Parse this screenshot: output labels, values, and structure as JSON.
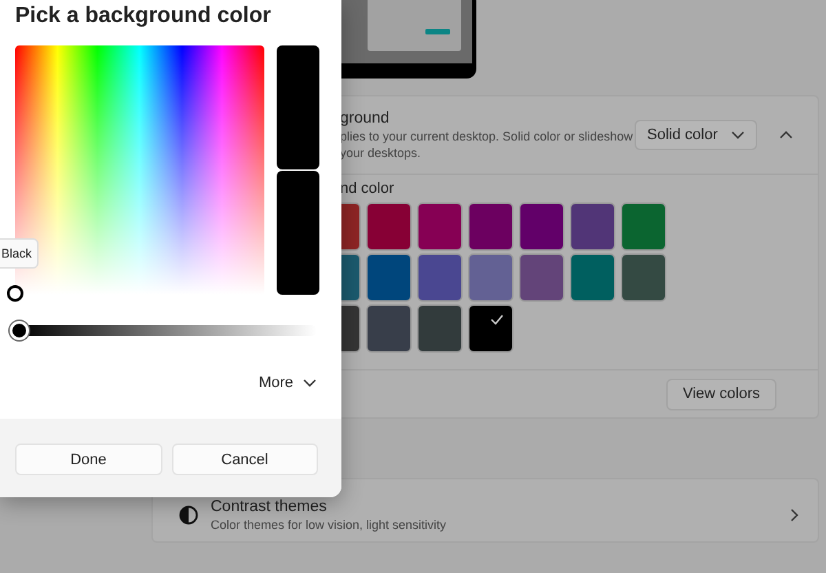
{
  "dialog": {
    "title": "Pick a background color",
    "tooltip": "Black",
    "brightness": {
      "level": 0
    },
    "more": {
      "label": "More",
      "expanded": false
    },
    "buttons": [
      {
        "label": "Done",
        "kind": "action"
      },
      {
        "label": "Cancel",
        "kind": "action"
      }
    ]
  },
  "background_card": {
    "title": "ground",
    "description_lines": [
      "plies to your current desktop. Solid color or slideshow",
      "your desktops."
    ],
    "dropdown": {
      "value": "Solid color"
    },
    "expanded": true,
    "swatch_label": "nd color",
    "swatches": [
      [
        {
          "color": "#8e2525",
          "selected": false
        },
        {
          "color": "#870035",
          "selected": false
        },
        {
          "color": "#860054",
          "selected": false
        },
        {
          "color": "#6c0060",
          "selected": false
        },
        {
          "color": "#620069",
          "selected": false
        },
        {
          "color": "#513577",
          "selected": false
        },
        {
          "color": "#0b6530",
          "selected": false
        }
      ],
      [
        {
          "color": "#1b5a6e",
          "selected": false
        },
        {
          "color": "#00467c",
          "selected": false
        },
        {
          "color": "#4a4791",
          "selected": false
        },
        {
          "color": "#636194",
          "selected": false
        },
        {
          "color": "#634479",
          "selected": false
        },
        {
          "color": "#005f5f",
          "selected": false
        },
        {
          "color": "#344a43",
          "selected": false
        }
      ],
      [
        {
          "color": "#353535",
          "selected": false
        },
        {
          "color": "#383e4a",
          "selected": false
        },
        {
          "color": "#323b3c",
          "selected": false
        },
        {
          "color": "#000000",
          "selected": true
        }
      ]
    ],
    "view_button": "View colors"
  },
  "contrast_card": {
    "title": "Contrast themes",
    "description": "Color themes for low vision, light sensitivity"
  }
}
